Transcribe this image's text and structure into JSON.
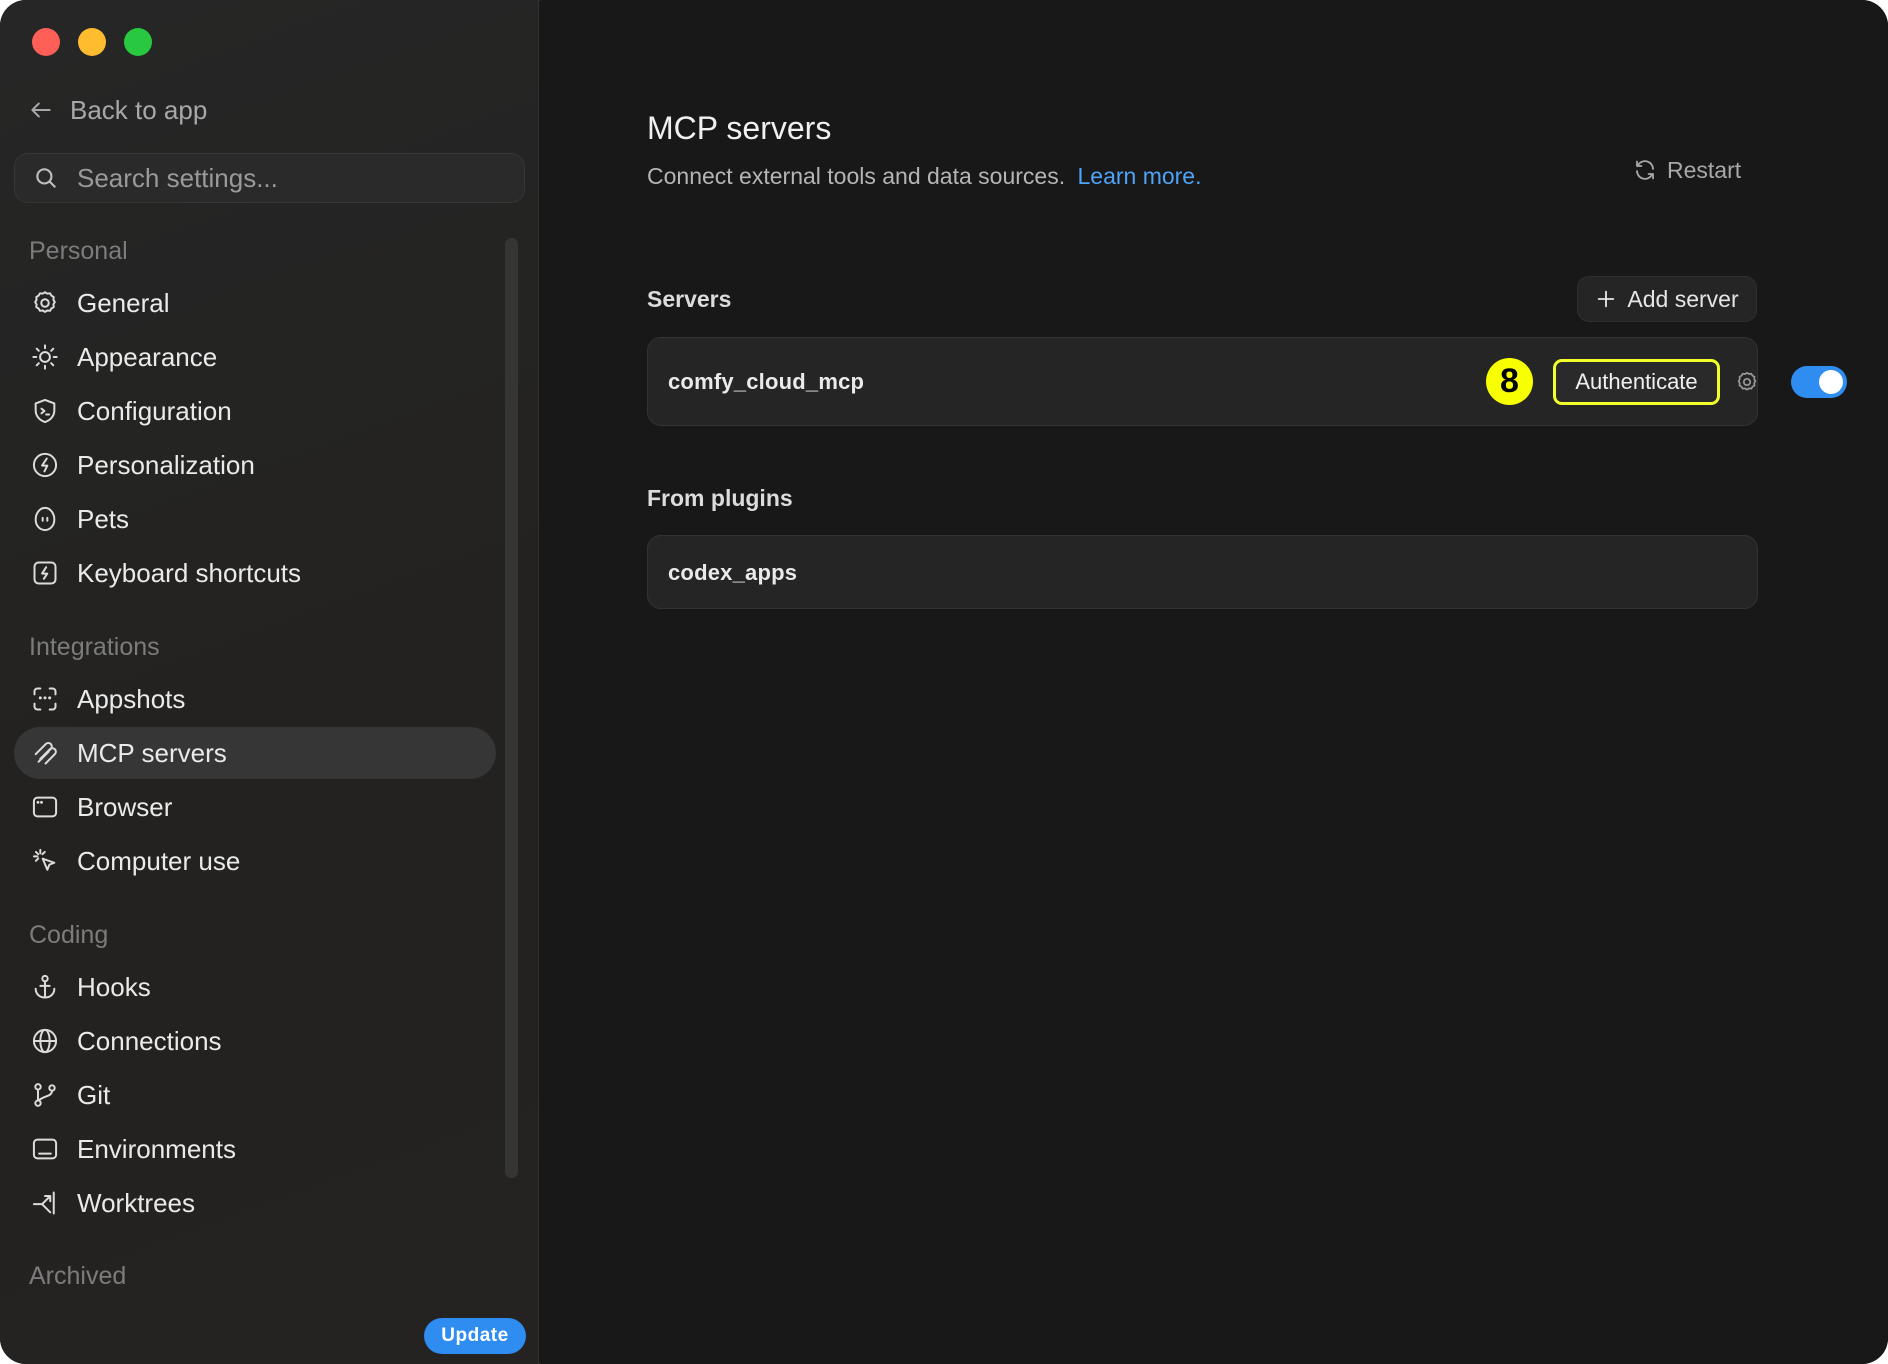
{
  "sidebar": {
    "back_label": "Back to app",
    "search_placeholder": "Search settings...",
    "sections": {
      "personal": "Personal",
      "integrations": "Integrations",
      "coding": "Coding",
      "archived": "Archived"
    },
    "items": {
      "general": "General",
      "appearance": "Appearance",
      "configuration": "Configuration",
      "personalization": "Personalization",
      "pets": "Pets",
      "keyboard_shortcuts": "Keyboard shortcuts",
      "appshots": "Appshots",
      "mcp_servers": "MCP servers",
      "browser": "Browser",
      "computer_use": "Computer use",
      "hooks": "Hooks",
      "connections": "Connections",
      "git": "Git",
      "environments": "Environments",
      "worktrees": "Worktrees"
    },
    "active_item": "MCP servers",
    "update_label": "Update"
  },
  "main": {
    "title": "MCP servers",
    "subtitle": "Connect external tools and data sources.",
    "learn_more": "Learn more.",
    "restart_label": "Restart",
    "servers_label": "Servers",
    "add_server_label": "Add server",
    "servers": [
      {
        "name": "comfy_cloud_mcp",
        "badge": "8",
        "authenticate_label": "Authenticate",
        "enabled": true
      }
    ],
    "plugins_label": "From plugins",
    "plugins": [
      {
        "name": "codex_apps"
      }
    ]
  },
  "colors": {
    "accent": "#2f8cf0",
    "link": "#4fa3f7",
    "highlight": "#f7ff00",
    "background": "#181818",
    "sidebar": "#242322"
  }
}
